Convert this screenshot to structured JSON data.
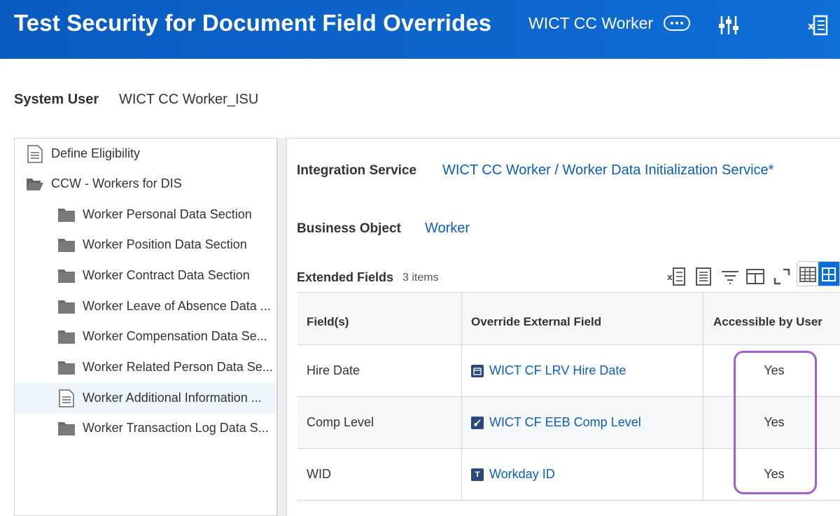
{
  "header": {
    "title": "Test Security for Document Field Overrides",
    "subtitle": "WICT CC Worker"
  },
  "system_user": {
    "label": "System User",
    "value": "WICT CC Worker_ISU"
  },
  "tree": {
    "items": [
      {
        "label": "Define Eligibility",
        "icon": "document-icon",
        "level": 0
      },
      {
        "label": "CCW - Workers for DIS",
        "icon": "folder-open-icon",
        "level": 0
      },
      {
        "label": "Worker Personal Data Section",
        "icon": "folder-icon",
        "level": 1
      },
      {
        "label": "Worker Position Data Section",
        "icon": "folder-icon",
        "level": 1
      },
      {
        "label": "Worker Contract Data Section",
        "icon": "folder-icon",
        "level": 1
      },
      {
        "label": "Worker Leave of Absence Data ...",
        "icon": "folder-icon",
        "level": 1
      },
      {
        "label": "Worker Compensation Data Se...",
        "icon": "folder-icon",
        "level": 1
      },
      {
        "label": "Worker Related Person Data Se...",
        "icon": "folder-icon",
        "level": 1
      },
      {
        "label": "Worker Additional Information ...",
        "icon": "document-icon",
        "level": 1,
        "selected": true
      },
      {
        "label": "Worker Transaction Log Data S...",
        "icon": "folder-icon",
        "level": 1
      }
    ]
  },
  "details": {
    "integration_service_label": "Integration Service",
    "integration_service_value": "WICT CC Worker / Worker Data Initialization Service*",
    "business_object_label": "Business Object",
    "business_object_value": "Worker"
  },
  "extended_fields": {
    "title": "Extended Fields",
    "count": "3 items",
    "columns": [
      "Field(s)",
      "Override External Field",
      "Accessible by User"
    ],
    "rows": [
      {
        "field": "Hire Date",
        "override": "WICT CF LRV Hire Date",
        "override_icon": "calendar-icon",
        "accessible": "Yes"
      },
      {
        "field": "Comp Level",
        "override": "WICT CF EEB Comp Level",
        "override_icon": "link-icon",
        "accessible": "Yes"
      },
      {
        "field": "WID",
        "override": "Workday ID",
        "override_icon": "text-type-icon",
        "override_icon_glyph": "T",
        "accessible": "Yes"
      }
    ]
  },
  "colors": {
    "header_bg": "#0a5bbf",
    "link": "#0a5eb8",
    "highlight": "#a35fd0"
  }
}
